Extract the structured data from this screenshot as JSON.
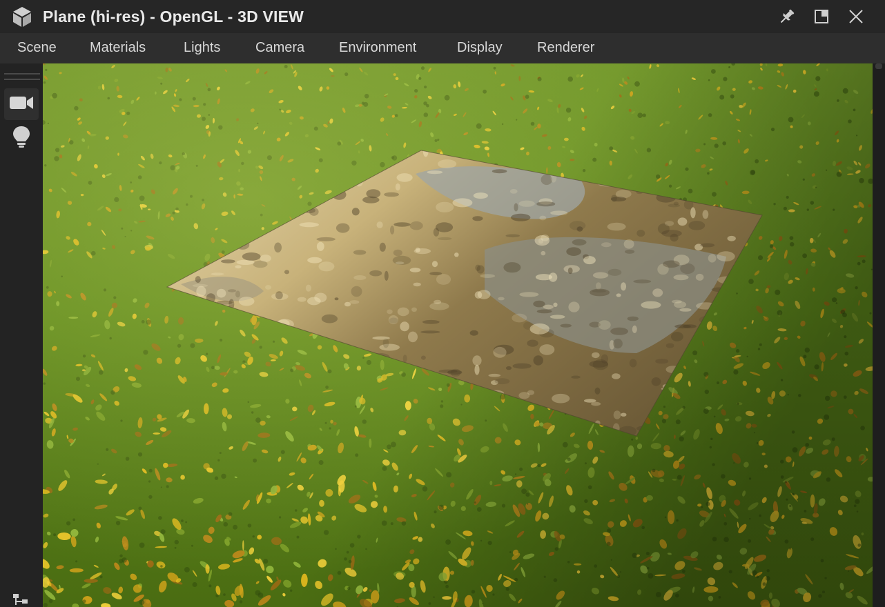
{
  "window": {
    "title": "Plane (hi-res) - OpenGL - 3D VIEW",
    "icons": {
      "app": "cube-icon",
      "pin": "pin-icon",
      "maximize": "maximize-icon",
      "close": "close-icon"
    }
  },
  "menubar": {
    "items": [
      {
        "label": "Scene"
      },
      {
        "label": "Materials"
      },
      {
        "label": "Lights"
      },
      {
        "label": "Camera"
      },
      {
        "label": "Environment"
      },
      {
        "label": "Display"
      },
      {
        "label": "Renderer"
      }
    ]
  },
  "toolbar": {
    "tools": [
      {
        "icon": "video-camera-icon",
        "active": true
      },
      {
        "icon": "light-bulb-icon",
        "active": false
      },
      {
        "icon": "hierarchy-icon",
        "active": false
      }
    ]
  },
  "viewport": {
    "scene": "grass-with-fallen-leaves",
    "object": "reflective-wet-plane",
    "colors": {
      "grass": "#5f8a1c",
      "leaf": "#d9b21c",
      "plane": "#b49a62"
    }
  },
  "colors": {
    "titlebar": "#262626",
    "menubar": "#2e2e2e",
    "text": "#e9e9e9",
    "menu_text": "#d8d8d8"
  }
}
